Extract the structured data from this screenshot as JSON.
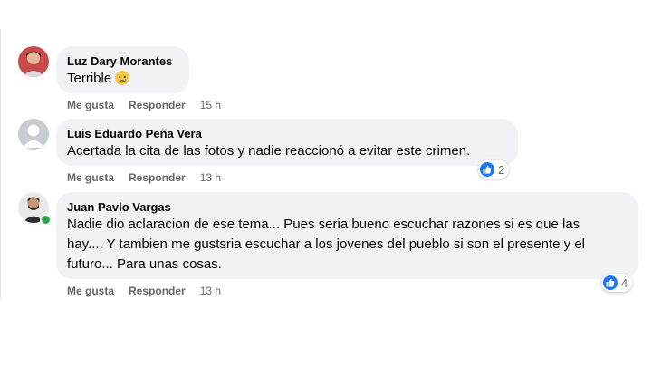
{
  "comments": [
    {
      "author": "Luz Dary Morantes",
      "text": "Terrible",
      "emoji": "crying-face-icon",
      "actions": {
        "like": "Me gusta",
        "reply": "Responder",
        "time": "15 h"
      }
    },
    {
      "author": "Luis Eduardo Peña Vera",
      "text": "Acertada la cita de las fotos y nadie reaccionó a evitar este crimen.",
      "actions": {
        "like": "Me gusta",
        "reply": "Responder",
        "time": "13 h"
      },
      "reaction_count": "2"
    },
    {
      "author": "Juan Pavlo Vargas",
      "text_lines": [
        "Nadie dio aclaracion de ese tema... Pues seria bueno escuchar razones si es que las",
        "hay.... Y tambien me gustsria escuchar a los jovenes del pueblo si son el presente y el",
        "futuro... Para unas cosas."
      ],
      "actions": {
        "like": "Me gusta",
        "reply": "Responder",
        "time": "13 h"
      },
      "reaction_count": "4",
      "online": true
    }
  ],
  "colors": {
    "bubble": "#f0f2f5",
    "like_blue": "#1877f2",
    "meta_gray": "#65676b",
    "online_green": "#31a24c"
  }
}
